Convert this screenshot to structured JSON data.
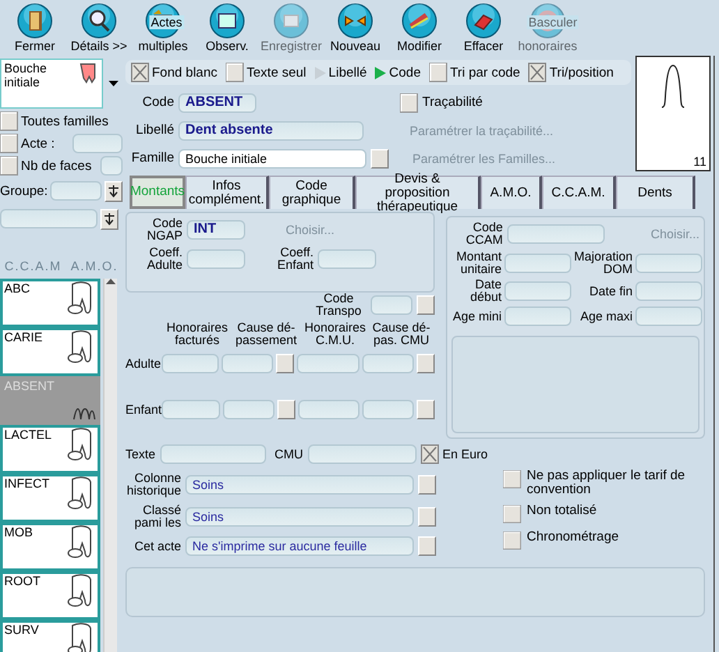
{
  "toolbar": [
    {
      "label": "Fermer",
      "disabled": false
    },
    {
      "label": "Détails >>",
      "disabled": false
    },
    {
      "overlay": "Actes",
      "label": "multiples",
      "disabled": false
    },
    {
      "label": "Observ.",
      "disabled": false
    },
    {
      "label": "Enregistrer",
      "disabled": true
    },
    {
      "label": "Nouveau",
      "disabled": false
    },
    {
      "label": "Modifier",
      "disabled": false
    },
    {
      "label": "Effacer",
      "disabled": false
    },
    {
      "overlay": "Basculer",
      "label": "honoraires",
      "disabled": true
    }
  ],
  "family_selector": {
    "value": "Bouche initiale"
  },
  "filters": [
    {
      "kind": "plain",
      "label": "Toutes familles",
      "checked": false
    },
    {
      "kind": "field",
      "label": "Acte :",
      "checked": false
    },
    {
      "kind": "field",
      "label": "Nb de faces",
      "checked": false
    }
  ],
  "group_label": "Groupe:",
  "list_header": [
    "C.C.A.M",
    "A.M.O."
  ],
  "acts": [
    {
      "code": "ABC",
      "selected": false
    },
    {
      "code": "CARIE",
      "selected": false
    },
    {
      "code": "ABSENT",
      "selected": true
    },
    {
      "code": "LACTEL",
      "selected": false
    },
    {
      "code": "INFECT",
      "selected": false
    },
    {
      "code": "MOB",
      "selected": false
    },
    {
      "code": "ROOT",
      "selected": false
    },
    {
      "code": "SURV",
      "selected": false
    }
  ],
  "options": [
    {
      "kind": "check",
      "label": "Fond blanc",
      "checked": true
    },
    {
      "kind": "check",
      "label": "Texte seul",
      "checked": false
    },
    {
      "kind": "sort",
      "label": "Libellé",
      "selected": false
    },
    {
      "kind": "sort",
      "label": "Code",
      "selected": true
    },
    {
      "kind": "check",
      "label": "Tri par code",
      "checked": false
    },
    {
      "kind": "check",
      "label": "Tri/position",
      "checked": true
    }
  ],
  "preview": {
    "number": "11"
  },
  "code": {
    "label": "Code",
    "value": "ABSENT"
  },
  "tracabilite": {
    "label": "Traçabilité",
    "checked": false
  },
  "libelle": {
    "label": "Libellé",
    "value": "Dent absente"
  },
  "param_tracabilite": {
    "label": "Paramétrer la traçabilité...",
    "disabled": true
  },
  "famille": {
    "label": "Famille",
    "value": "Bouche initiale"
  },
  "param_familles": {
    "label": "Paramétrer les Familles...",
    "disabled": true
  },
  "tabs": [
    {
      "label": "Montants",
      "selected": true
    },
    {
      "label": "Infos complément.",
      "selected": false
    },
    {
      "label": "Code graphique",
      "selected": false
    },
    {
      "label": "Devis & proposition thérapeutique",
      "selected": false
    },
    {
      "label": "A.M.O.",
      "selected": false
    },
    {
      "label": "C.C.A.M.",
      "selected": false
    },
    {
      "label": "Dents",
      "selected": false
    }
  ],
  "ngap": {
    "code_label": "Code NGAP",
    "code": "INT",
    "choose": {
      "label": "Choisir...",
      "disabled": true
    },
    "coeff_adulte": "Coeff. Adulte",
    "coeff_enfant": "Coeff. Enfant"
  },
  "ccam": {
    "code_label": "Code CCAM",
    "choose": {
      "label": "Choisir...",
      "disabled": true
    },
    "fields": [
      "Montant unitaire",
      "Majoration DOM",
      "Date début",
      "Date fin",
      "Age mini",
      "Age maxi"
    ]
  },
  "transpo_label": "Code Transpo",
  "fee_columns": [
    "Honoraires facturés",
    "Cause dé-passement",
    "Honoraires C.M.U.",
    "Cause dé-pas. CMU"
  ],
  "fee_rows": [
    "Adulte",
    "Enfant"
  ],
  "texte_label": "Texte",
  "cmu_label": "CMU",
  "en_euro": {
    "label": "En Euro",
    "checked": true
  },
  "classification": [
    {
      "label": "Colonne historique",
      "value": "Soins"
    },
    {
      "label": "Classé pami les",
      "value": "Soins"
    },
    {
      "label": "Cet acte",
      "value": "Ne s'imprime sur aucune feuille"
    }
  ],
  "flags": [
    {
      "label": "Ne pas appliquer le tarif de convention",
      "checked": false
    },
    {
      "label": "Non totalisé",
      "checked": false
    },
    {
      "label": "Chronométrage",
      "checked": false
    }
  ]
}
